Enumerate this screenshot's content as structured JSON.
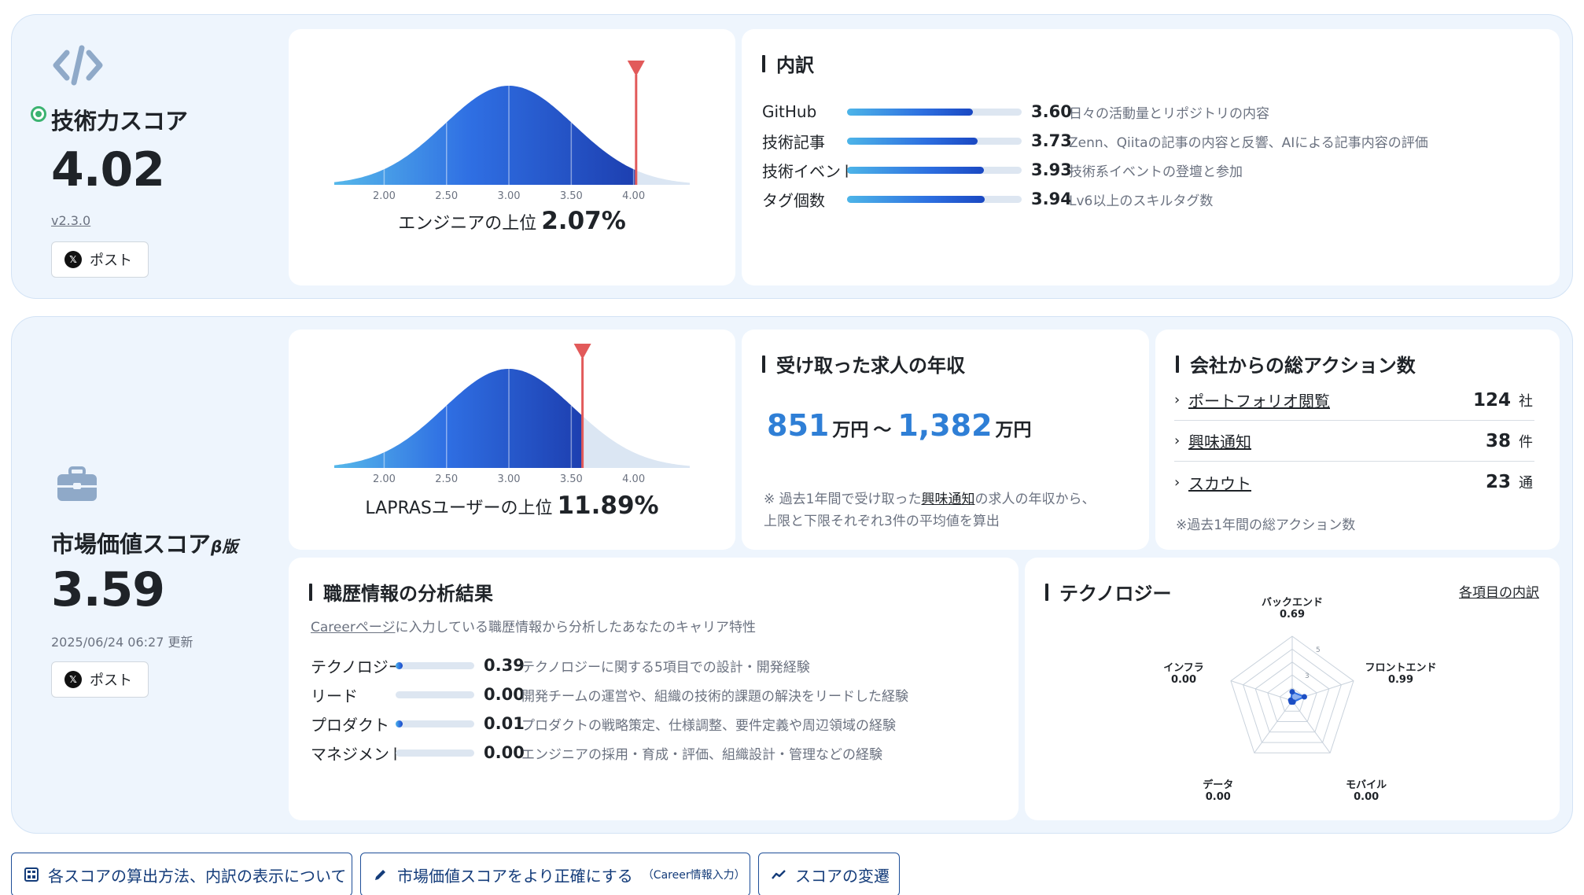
{
  "tech": {
    "title": "技術力スコア",
    "score": "4.02",
    "version": "v2.3.0",
    "post_label": "ポスト",
    "distribution": {
      "ticks": [
        "2.00",
        "2.50",
        "3.00",
        "3.50",
        "4.00"
      ],
      "marker_value": 4.02,
      "mean": 3.0,
      "sd": 0.52,
      "range": [
        1.6,
        4.45
      ]
    },
    "percentile_prefix": "エンジニアの上位",
    "percentile_value": "2.07%",
    "breakdown": {
      "title": "内訳",
      "items": [
        {
          "label": "GitHub",
          "value": "3.60",
          "level": 0.72,
          "desc": "日々の活動量とリポジトリの内容"
        },
        {
          "label": "技術記事",
          "value": "3.73",
          "level": 0.746,
          "desc": "Zenn、Qiitaの記事の内容と反響、AIによる記事内容の評価"
        },
        {
          "label": "技術イベント",
          "value": "3.93",
          "level": 0.786,
          "desc": "技術系イベントの登壇と参加"
        },
        {
          "label": "タグ個数",
          "value": "3.94",
          "level": 0.788,
          "desc": "Lv6以上のスキルタグ数"
        }
      ]
    }
  },
  "market": {
    "title": "市場価値スコア",
    "beta": "β版",
    "score": "3.59",
    "updated": "2025/06/24 06:27 更新",
    "post_label": "ポスト",
    "distribution": {
      "ticks": [
        "2.00",
        "2.50",
        "3.00",
        "3.50",
        "4.00"
      ],
      "marker_value": 3.59,
      "mean": 3.0,
      "sd": 0.52,
      "range": [
        1.6,
        4.45
      ]
    },
    "percentile_prefix": "LAPRASユーザーの上位",
    "percentile_value": "11.89%",
    "salary": {
      "title": "受け取った求人の年収",
      "low": "851",
      "high": "1,382",
      "unit": "万円",
      "tilde": "〜",
      "note_before": "※ 過去1年間で受け取った",
      "note_link": "興味通知",
      "note_after": "の求人の年収から、",
      "note_line2": "上限と下限それぞれ3件の平均値を算出"
    },
    "actions": {
      "title": "会社からの総アクション数",
      "items": [
        {
          "label": "ポートフォリオ閲覧",
          "count": "124",
          "unit": "社"
        },
        {
          "label": "興味通知",
          "count": "38",
          "unit": "件"
        },
        {
          "label": "スカウト",
          "count": "23",
          "unit": "通"
        }
      ],
      "note": "※過去1年間の総アクション数"
    },
    "career": {
      "title": "職歴情報の分析結果",
      "subtitle_link": "Careerページ",
      "subtitle_rest": "に入力している職歴情報から分析したあなたのキャリア特性",
      "items": [
        {
          "label": "テクノロジー",
          "value": "0.39",
          "level": 0.078,
          "desc": "テクノロジーに関する5項目での設計・開発経験"
        },
        {
          "label": "リード",
          "value": "0.00",
          "level": 0.0,
          "desc": "開発チームの運営や、組織の技術的課題の解決をリードした経験"
        },
        {
          "label": "プロダクト",
          "value": "0.01",
          "level": 0.002,
          "desc": "プロダクトの戦略策定、仕様調整、要件定義や周辺領域の経験"
        },
        {
          "label": "マネジメント",
          "value": "0.00",
          "level": 0.0,
          "desc": "エンジニアの採用・育成・評価、組織設計・管理などの経験"
        }
      ]
    },
    "technology": {
      "title": "テクノロジー",
      "link": "各項目の内訳",
      "scale_labels": [
        "5",
        "3"
      ],
      "axes": [
        {
          "name": "バックエンド",
          "value": "0.69",
          "v": 0.69
        },
        {
          "name": "フロントエンド",
          "value": "0.99",
          "v": 0.99
        },
        {
          "name": "モバイル",
          "value": "0.00",
          "v": 0.0
        },
        {
          "name": "データ",
          "value": "0.00",
          "v": 0.0
        },
        {
          "name": "インフラ",
          "value": "0.00",
          "v": 0.0
        }
      ],
      "max": 5
    }
  },
  "buttons": {
    "calc": "各スコアの算出方法、内訳の表示について",
    "improve": "市場価値スコアをより正確にする",
    "improve_small": "（Career情報入力）",
    "history": "スコアの変遷"
  },
  "colors": {
    "accent": "#2f7fd6",
    "marker": "#e25a5a",
    "panel_bg": "#eef5fd",
    "status_dot": "#3cb371"
  }
}
